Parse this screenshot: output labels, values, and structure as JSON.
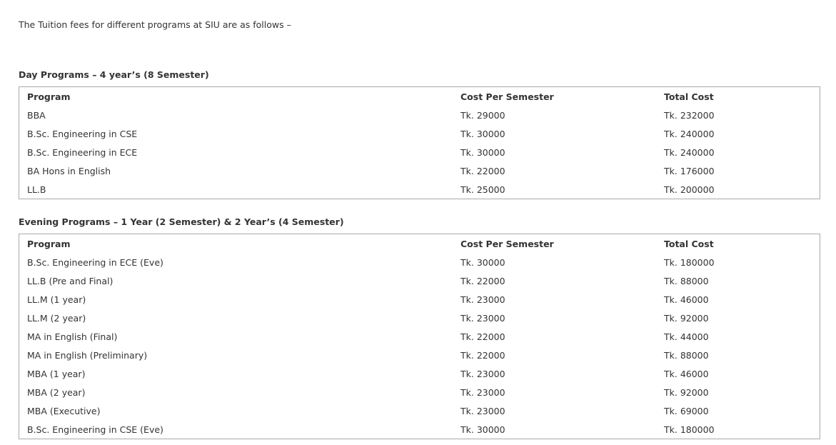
{
  "intro_text": "The Tuition fees for different programs at SIU are as follows –",
  "day_programs": {
    "heading": "Day Programs – 4 year’s (8 Semester)",
    "columns": [
      "Program",
      "Cost Per Semester",
      "Total Cost"
    ],
    "rows": [
      [
        "BBA",
        "Tk. 29000",
        "Tk. 232000"
      ],
      [
        "B.Sc. Engineering in CSE",
        "Tk. 30000",
        "Tk. 240000"
      ],
      [
        "B.Sc. Engineering in ECE",
        "Tk. 30000",
        "Tk. 240000"
      ],
      [
        "BA Hons in English",
        "Tk. 22000",
        "Tk. 176000"
      ],
      [
        "LL.B",
        "Tk. 25000",
        "Tk. 200000"
      ]
    ]
  },
  "evening_programs": {
    "heading": "Evening Programs – 1 Year (2 Semester) & 2 Year’s (4 Semester)",
    "columns": [
      "Program",
      "Cost Per Semester",
      "Total Cost"
    ],
    "rows": [
      [
        "B.Sc. Engineering in ECE (Eve)",
        "Tk. 30000",
        "Tk. 180000"
      ],
      [
        "LL.B (Pre and Final)",
        "Tk. 22000",
        "Tk. 88000"
      ],
      [
        "LL.M (1 year)",
        "Tk. 23000",
        "Tk. 46000"
      ],
      [
        "LL.M (2 year)",
        "Tk. 23000",
        "Tk. 92000"
      ],
      [
        "MA in English (Final)",
        "Tk. 22000",
        "Tk. 44000"
      ],
      [
        "MA in English (Preliminary)",
        "Tk. 22000",
        "Tk. 88000"
      ],
      [
        "MBA (1 year)",
        "Tk. 23000",
        "Tk. 46000"
      ],
      [
        "MBA (2 year)",
        "Tk. 23000",
        "Tk. 92000"
      ],
      [
        "MBA (Executive)",
        "Tk. 23000",
        "Tk. 69000"
      ],
      [
        "B.Sc. Engineering in CSE (Eve)",
        "Tk. 30000",
        "Tk. 180000"
      ]
    ]
  }
}
